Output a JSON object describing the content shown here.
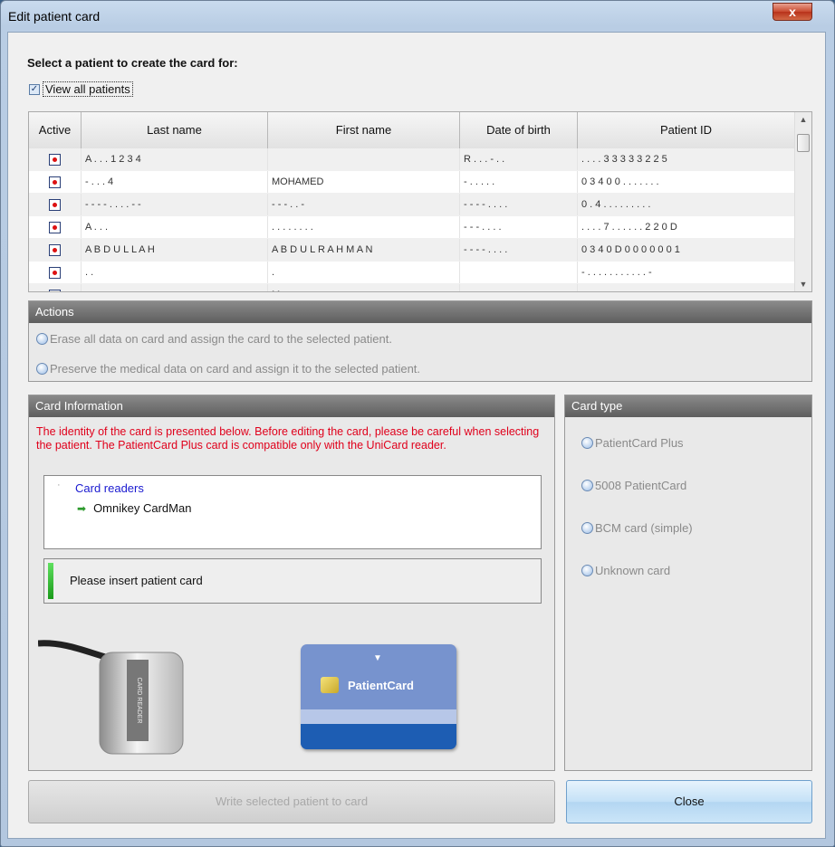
{
  "window": {
    "title": "Edit patient card",
    "close_glyph": "x"
  },
  "select": {
    "heading": "Select a patient to create the card for:",
    "view_all_label": "View all patients",
    "view_all_checked": true
  },
  "grid": {
    "columns": [
      "Active",
      "Last name",
      "First name",
      "Date of birth",
      "Patient ID"
    ],
    "rows": [
      {
        "last": "A . . . 1 2 3 4",
        "first": "",
        "dob": "R . . . - . .",
        "pid": ". . . . 3 3 3 3 3 2 2 5"
      },
      {
        "last": "- . . . 4",
        "first": "MOHAMED",
        "dob": "- . . .  . .",
        "pid": "0 3 4 0 0 . . . . . . ."
      },
      {
        "last": "- - - - . . . . - -",
        "first": "- - - . . -",
        "dob": "- - - - . . . .",
        "pid": "0 . 4 . . . . . . . . ."
      },
      {
        "last": "A . . .",
        "first": ". . . . . . . .",
        "dob": "- - - . . . .",
        "pid": ". . . . 7 . . . . . . 2 2 0 D"
      },
      {
        "last": "A B D U L L A H",
        "first": "A B D U L  R A H M A N",
        "dob": "- - - - . . . .",
        "pid": "0 3 4 0 D 0 0 0 0 0 0 1"
      },
      {
        "last": ". .",
        "first": ".",
        "dob": "",
        "pid": "- . . . . . . . . . . . -"
      },
      {
        "last": "",
        "first": "M . . . . . .",
        "dob": "",
        "pid": ""
      }
    ]
  },
  "actions": {
    "header": "Actions",
    "erase_label": "Erase all data on card and assign the card to the selected patient.",
    "preserve_label": "Preserve the medical data on card and assign it to the selected patient."
  },
  "card_info": {
    "header": "Card Information",
    "warning": "The identity of the card is presented below. Before editing the card, please be careful when selecting the patient. The PatientCard Plus card is compatible only with the UniCard reader.",
    "readers_root": "Card readers",
    "reader_name": "Omnikey CardMan",
    "status": "Please insert patient card",
    "reader_device_text": "CARD READER",
    "card_brand": "PatientCard"
  },
  "card_type": {
    "header": "Card type",
    "options": [
      "PatientCard Plus",
      "5008 PatientCard",
      "BCM card (simple)",
      "Unknown card"
    ]
  },
  "buttons": {
    "write": "Write selected patient to card",
    "close": "Close"
  }
}
